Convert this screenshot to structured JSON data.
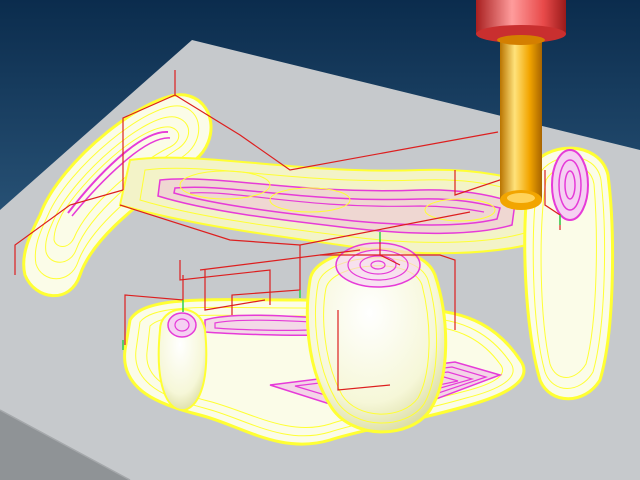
{
  "viewport": {
    "background_top": "#0b2c4d",
    "background_bottom": "#4a7fa6"
  },
  "scene": {
    "stock_top_color": "#c6c9cc",
    "stock_side_color": "#8f9396",
    "part_surface_color": "#fbfce8",
    "part_shadow_color": "#d9dba0",
    "finishing_toolpath_color": "#ffff33",
    "roughing_toolpath_color": "#e63bd8",
    "rapid_move_color": "#dd1f1f",
    "lead_move_color": "#2fd04a"
  },
  "tool": {
    "holder_color": "#e84a4a",
    "holder_highlight": "#ff9c9c",
    "shank_color": "#f2a500",
    "shank_highlight": "#ffe27a"
  }
}
